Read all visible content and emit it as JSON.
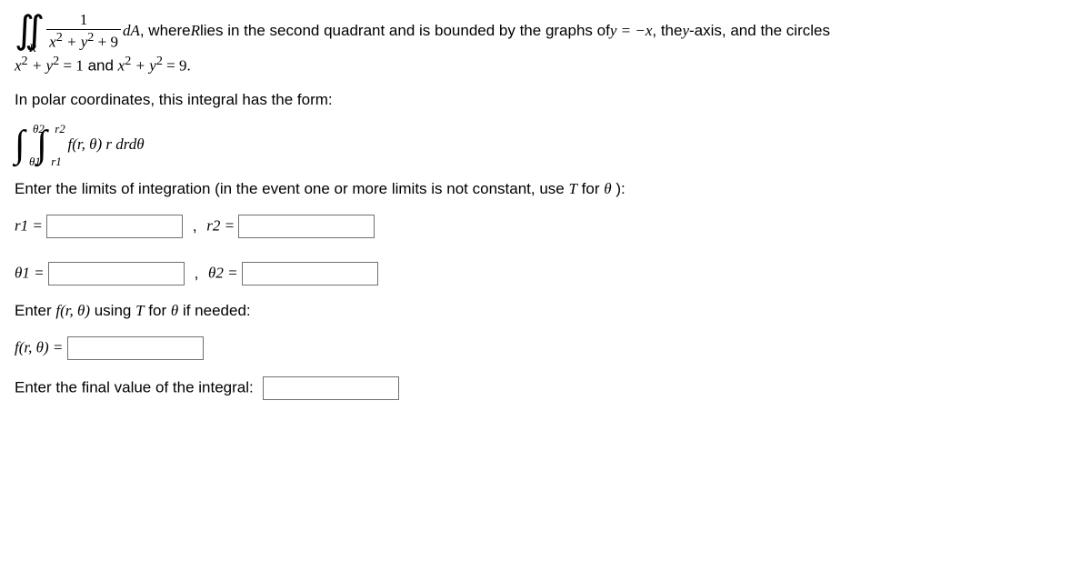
{
  "line1": {
    "frac_num": "1",
    "frac_den_pre": "x",
    "frac_den_mid": " + y",
    "frac_den_post": " + 9",
    "R_sub": "R",
    "dA": " dA",
    "text1": " , where ",
    "Rvar": "R",
    "text2": " lies in the second quadrant and is bounded by the graphs of ",
    "eq1": "y = −x",
    "text3": ", the ",
    "yaxis": "y",
    "text4": "-axis, and the circles"
  },
  "line2": {
    "eq_a": "x",
    "eq_b": " + y",
    "eq_c": " = 1",
    "and_text": " and ",
    "eq_d": "x",
    "eq_e": " + y",
    "eq_f": " = 9."
  },
  "polar_intro": "In polar coordinates, this integral has the form:",
  "integral_form": {
    "th1_low": "θ1",
    "th2_up": "θ2",
    "r1_low": "r1",
    "r2_up": "r2",
    "f": "f(r, θ) r drdθ"
  },
  "limits_text": {
    "pre": "Enter the limits of integration (in the event one or more limits is not constant, use ",
    "T": "T",
    "mid": " for ",
    "theta": "θ",
    "post": " ):"
  },
  "labels": {
    "r1": "r1 = ",
    "r2": "r2 = ",
    "th1": "θ1 = ",
    "th2": "θ2 = "
  },
  "enter_f": {
    "pre": "Enter ",
    "f": "f(r, θ)",
    "mid": " using ",
    "T": "T",
    "mid2": " for ",
    "theta": "θ",
    "post": " if needed:"
  },
  "f_label": "f(r, θ) = ",
  "final_text": "Enter the final value of the integral:"
}
